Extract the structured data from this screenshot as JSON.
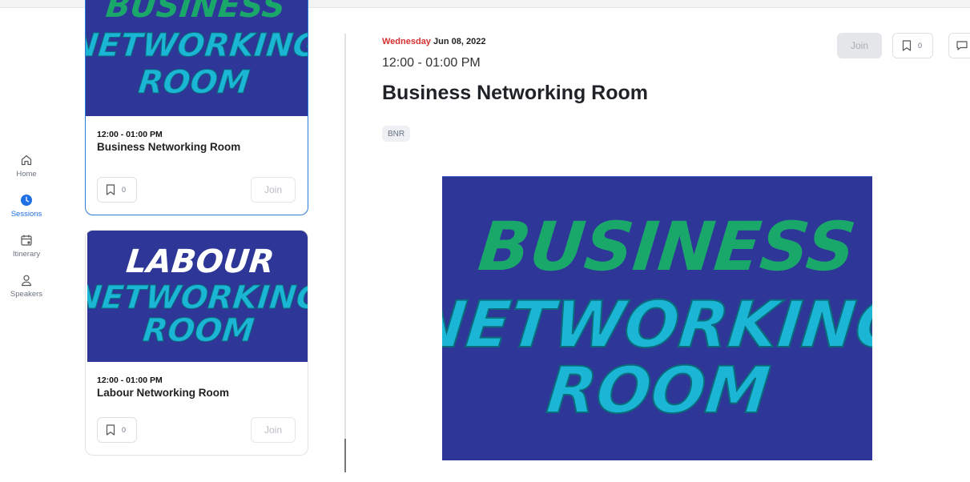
{
  "nav": {
    "items": [
      {
        "label": "Home",
        "icon": "home-icon"
      },
      {
        "label": "Sessions",
        "icon": "clock-icon",
        "active": true
      },
      {
        "label": "Itinerary",
        "icon": "calendar-icon"
      },
      {
        "label": "Speakers",
        "icon": "user-icon"
      }
    ]
  },
  "sessions": [
    {
      "time": "12:00 - 01:00 PM",
      "title": "Business Networking Room",
      "bookmark_count": "0",
      "join_label": "Join",
      "image_text": [
        "BUSINESS",
        "NETWORKING",
        "ROOM"
      ],
      "selected": true
    },
    {
      "time": "12:00 - 01:00 PM",
      "title": "Labour Networking Room",
      "bookmark_count": "0",
      "join_label": "Join",
      "image_text": [
        "LABOUR",
        "NETWORKING",
        "ROOM"
      ]
    }
  ],
  "detail": {
    "day_of_week": "Wednesday",
    "date": "Jun 08, 2022",
    "time": "12:00 - 01:00 PM",
    "title": "Business Networking Room",
    "tag": "BNR",
    "join_label": "Join",
    "bookmark_count": "0",
    "image_text": [
      "BUSINESS",
      "NETWORKING",
      "ROOM"
    ]
  },
  "colors": {
    "image_bg": "#2e3797",
    "text_green": "#1aa86a",
    "text_cyan": "#1bb6d6",
    "text_white": "#ffffff",
    "accent": "#1f6fe5",
    "date_red": "#d62f2f"
  }
}
